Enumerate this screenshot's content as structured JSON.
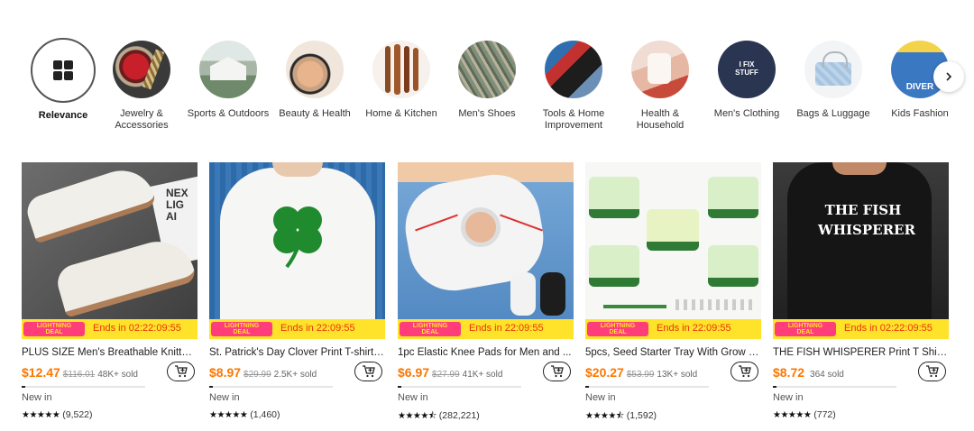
{
  "categories": [
    {
      "label": "Relevance",
      "icon": "grid-icon"
    },
    {
      "label": "Jewelry & Accessories"
    },
    {
      "label": "Sports & Outdoors"
    },
    {
      "label": "Beauty & Health"
    },
    {
      "label": "Home & Kitchen"
    },
    {
      "label": "Men's Shoes"
    },
    {
      "label": "Tools & Home Improvement"
    },
    {
      "label": "Health & Household"
    },
    {
      "label": "Men's Clothing"
    },
    {
      "label": "Bags & Luggage"
    },
    {
      "label": "Kids Fashion"
    }
  ],
  "deal": {
    "badge_top": "LIGHTNING",
    "badge_bottom": "DEAL"
  },
  "products": [
    {
      "image_text": "NEX\nLIG\nAI",
      "ends": "Ends in 02:22:09:55",
      "title": "PLUS SIZE Men's Breathable Knitted ...",
      "price": "$12.47",
      "original": "$116.01",
      "sold": "48K+ sold",
      "progress": 0.03,
      "new_in": "New in",
      "rating": 5,
      "reviews": "(9,522)"
    },
    {
      "image_text": "",
      "ends": "Ends in 22:09:55",
      "title": "St. Patrick's Day Clover Print T-shirt, ...",
      "price": "$8.97",
      "original": "$29.99",
      "sold": "2.5K+ sold",
      "progress": 0.03,
      "new_in": "New in",
      "rating": 5,
      "reviews": "(1,460)"
    },
    {
      "image_text": "",
      "ends": "Ends in 22:09:55",
      "title": "1pc Elastic Knee Pads for Men and ...",
      "price": "$6.97",
      "original": "$27.99",
      "sold": "41K+ sold",
      "progress": 0.03,
      "new_in": "New in",
      "rating": 4.5,
      "reviews": "(282,221)"
    },
    {
      "image_text": "",
      "ends": "Ends in 22:09:55",
      "title": "5pcs, Seed Starter Tray With Grow Li...",
      "price": "$20.27",
      "original": "$53.99",
      "sold": "13K+ sold",
      "progress": 0.03,
      "new_in": "New in",
      "rating": 4.5,
      "reviews": "(1,592)"
    },
    {
      "image_text": "THE FISH WHISPERER",
      "ends": "Ends in 02:22:09:55",
      "title": "THE FISH WHISPERER Print T Shirt, T...",
      "price": "$8.72",
      "original": "",
      "sold": "364 sold",
      "progress": 0.03,
      "new_in": "New in",
      "rating": 5,
      "reviews": "(772)"
    }
  ],
  "colors": {
    "price": "#fb7701",
    "deal_bar": "#ffe22a",
    "deal_badge": "#ff3d7a",
    "ends_text": "#e8340c"
  }
}
